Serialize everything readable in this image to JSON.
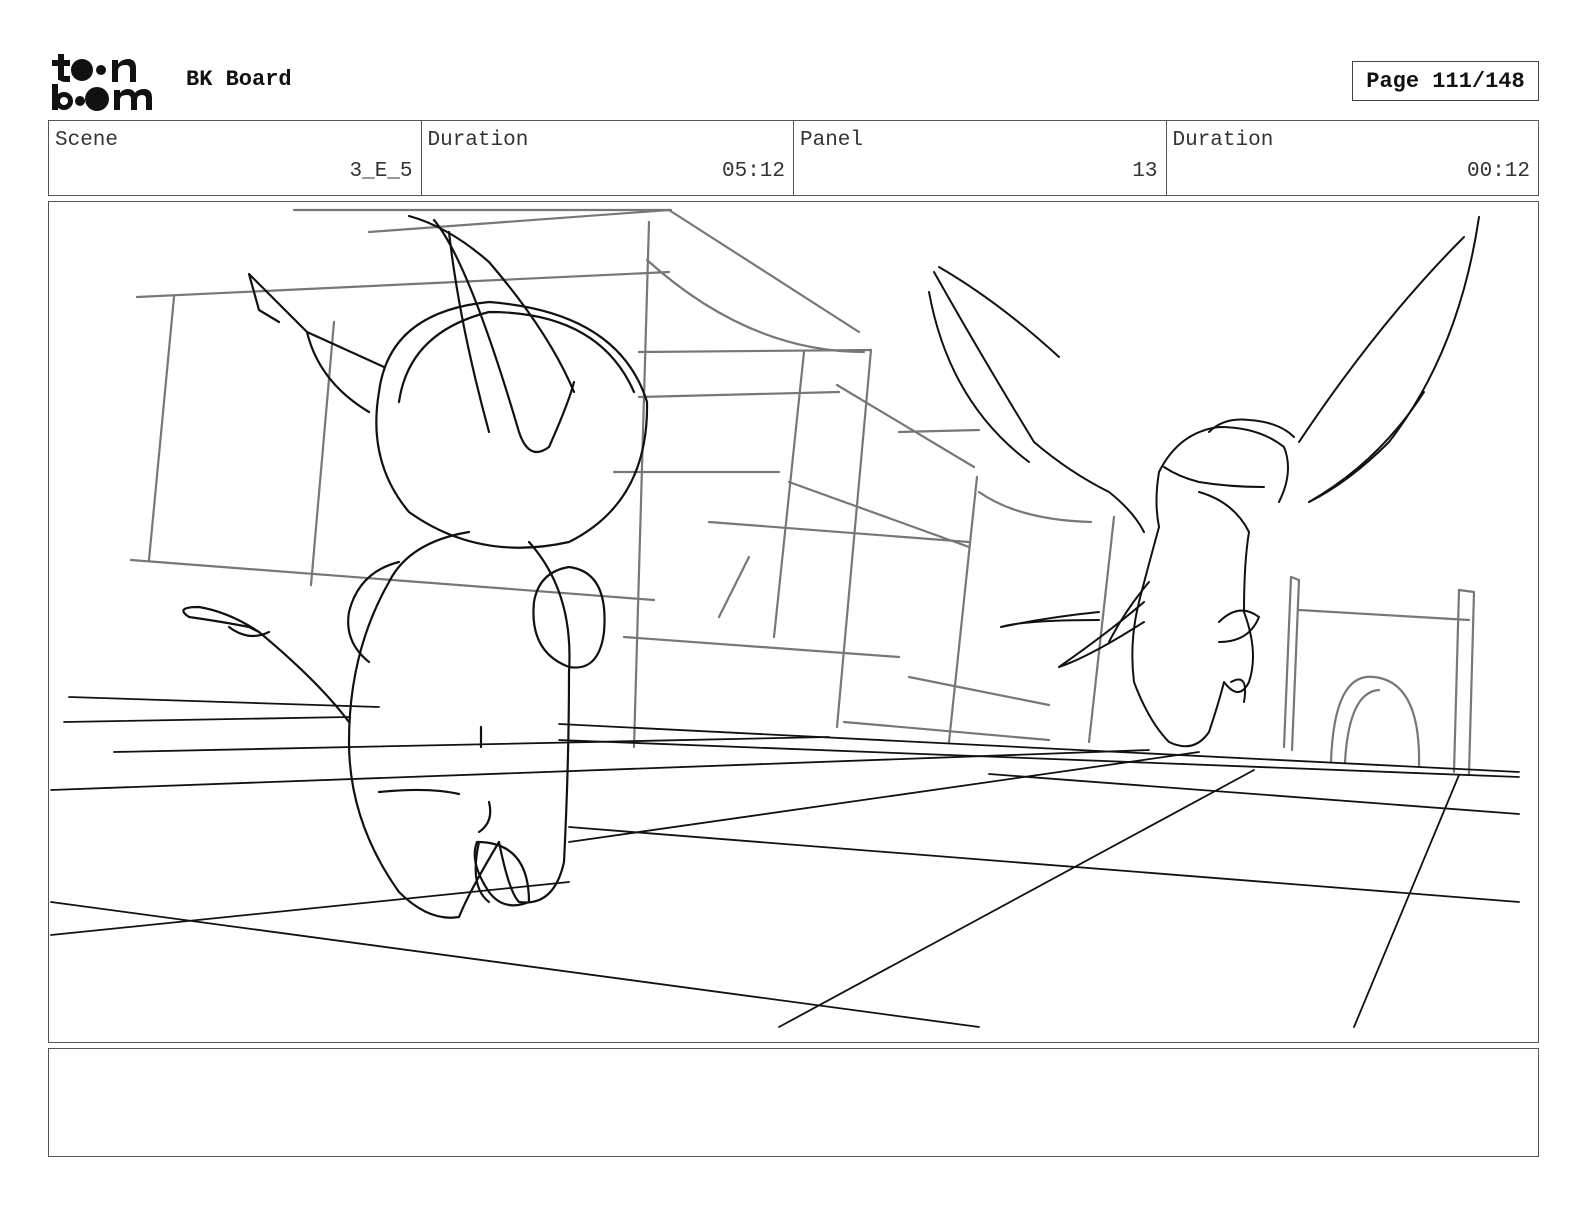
{
  "header": {
    "logo_text": "toon boom",
    "board_title": "BK Board",
    "page_label": "Page 111/148"
  },
  "info": {
    "scene_label": "Scene",
    "scene_value": "3_E_5",
    "scene_duration_label": "Duration",
    "scene_duration_value": "05:12",
    "panel_label": "Panel",
    "panel_value": "13",
    "panel_duration_label": "Duration",
    "panel_duration_value": "00:12"
  },
  "notes": {
    "text": ""
  },
  "colors": {
    "ink": "#111111",
    "pencil_grey": "#777777",
    "frame": "#555555"
  }
}
